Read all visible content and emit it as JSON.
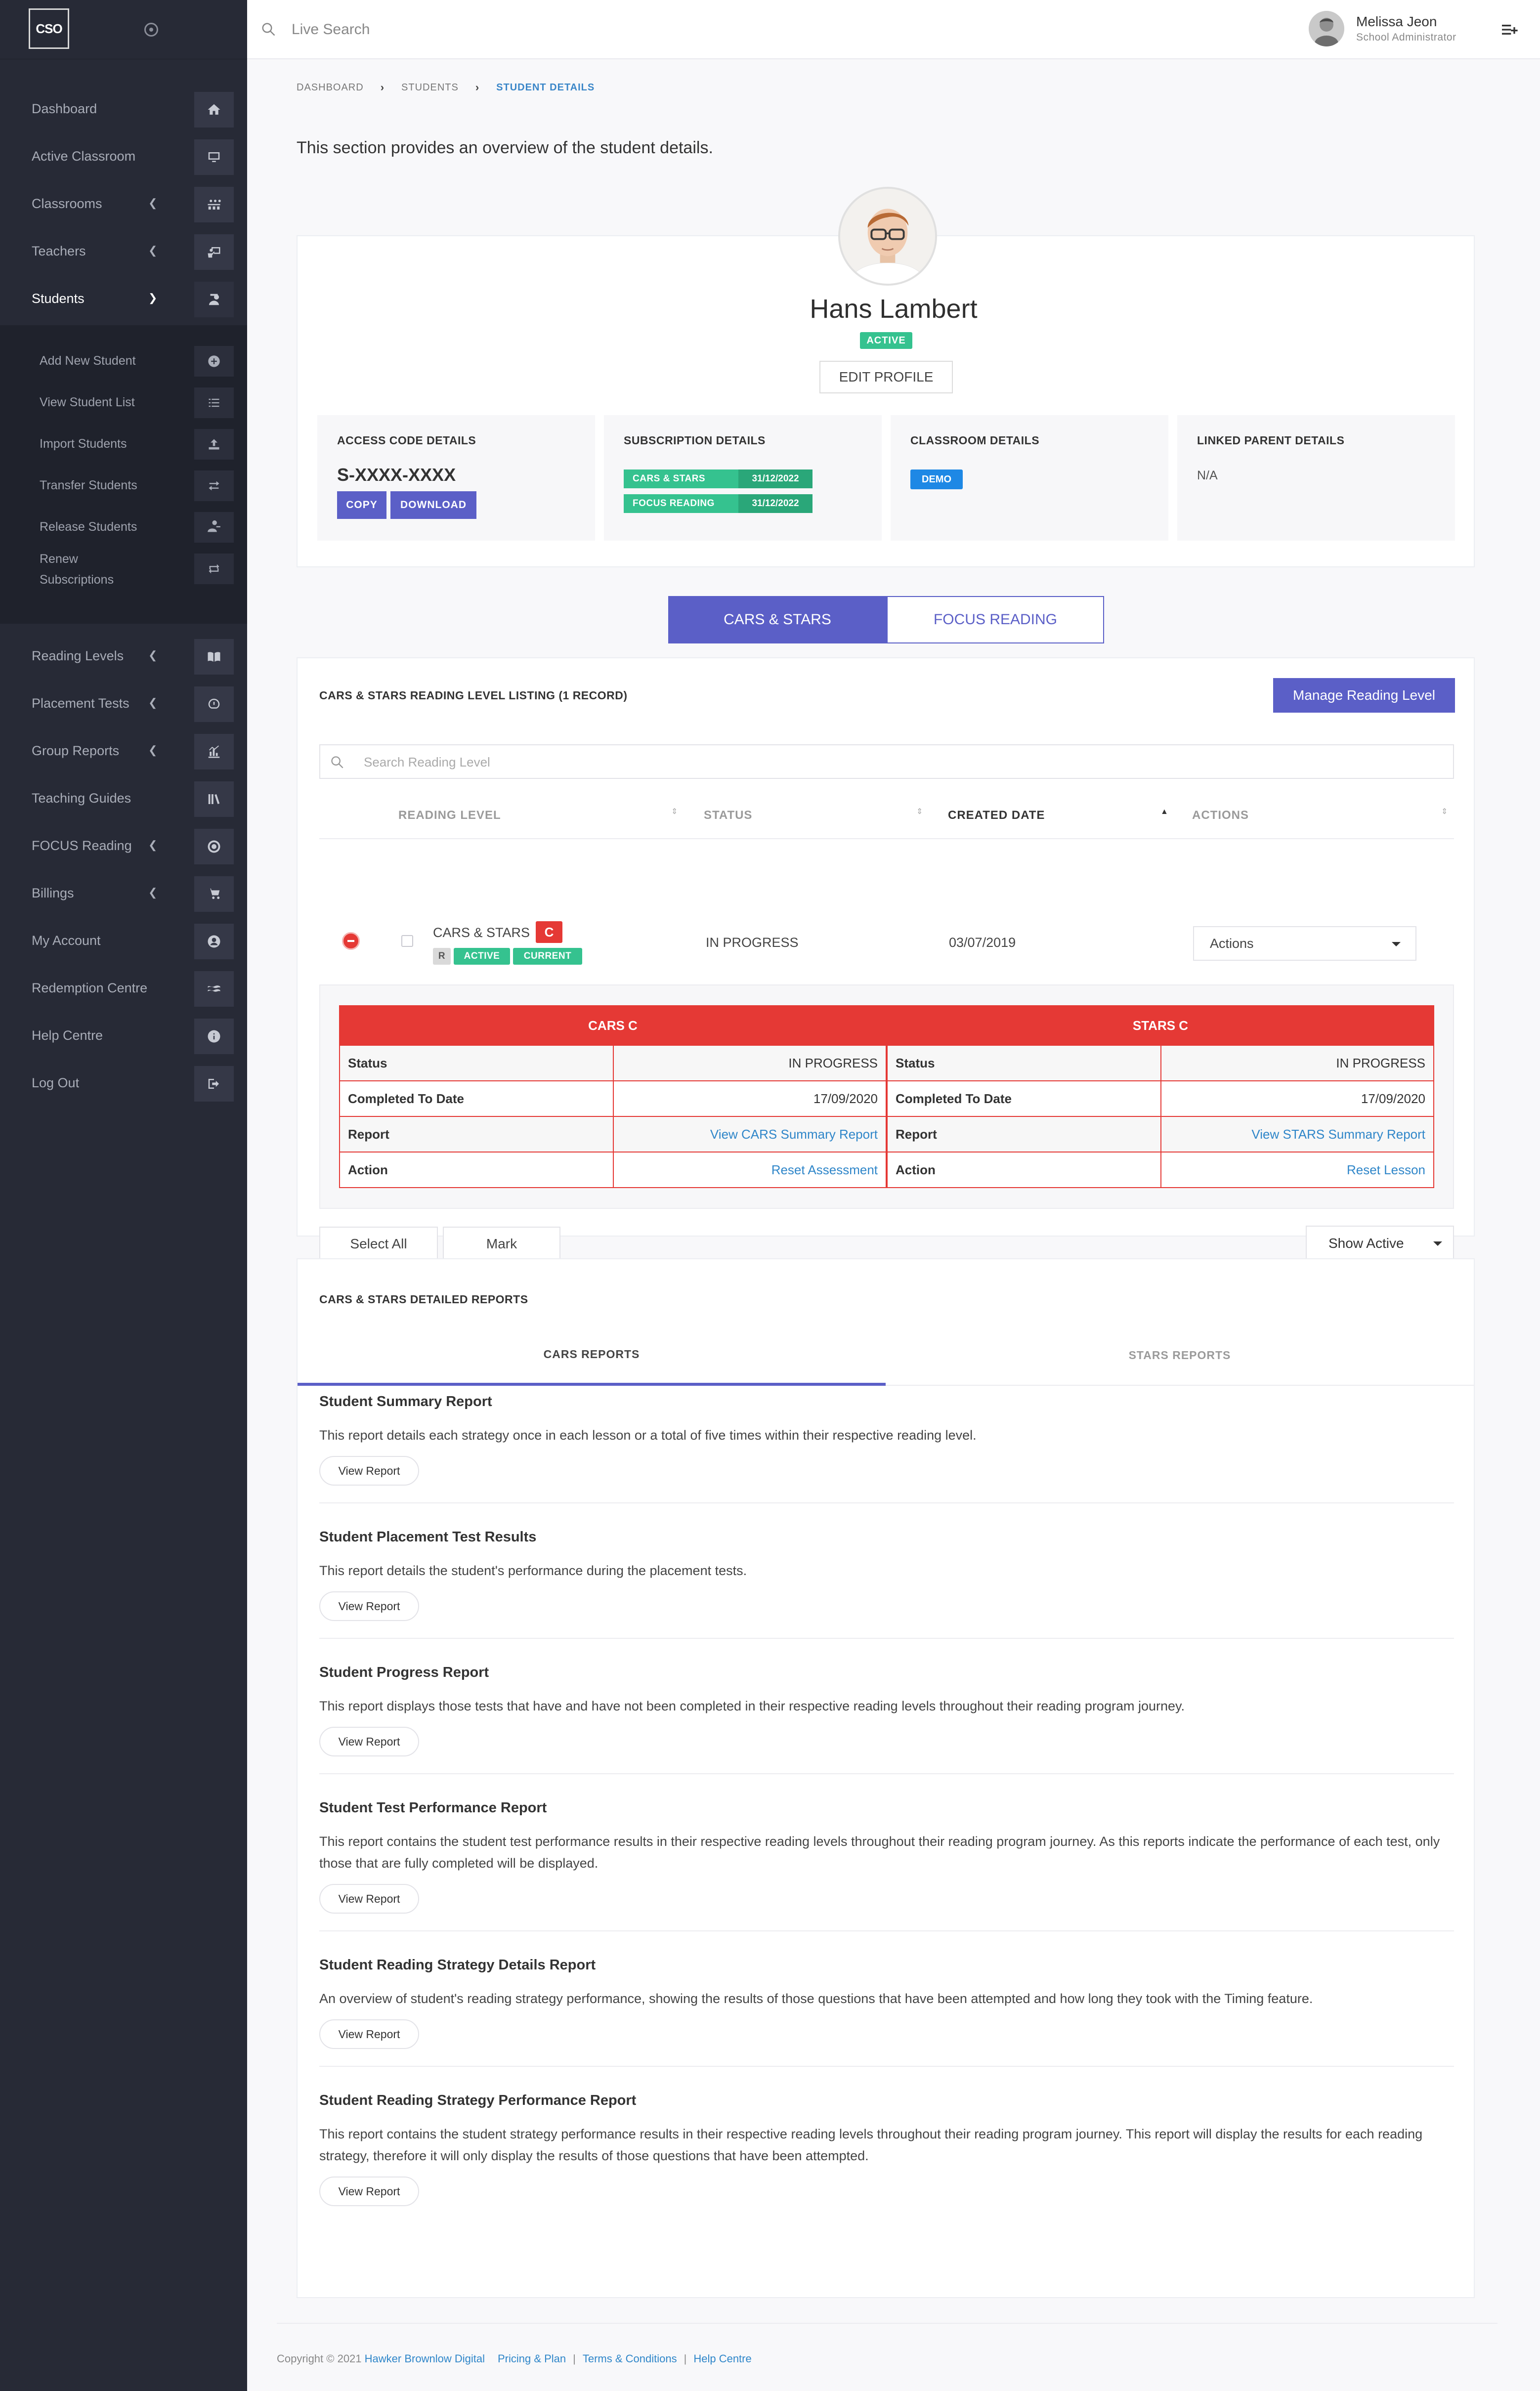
{
  "app": {
    "logo_text": "CSO"
  },
  "header": {
    "search_placeholder": "Live Search",
    "user_name": "Melissa Jeon",
    "user_role": "School Administrator"
  },
  "sidebar": {
    "items": [
      {
        "label": "Dashboard",
        "icon": "home-icon"
      },
      {
        "label": "Active Classroom",
        "icon": "monitor-icon"
      },
      {
        "label": "Classrooms",
        "icon": "classroom-icon"
      },
      {
        "label": "Teachers",
        "icon": "teacher-icon"
      },
      {
        "label": "Students",
        "icon": "student-icon"
      },
      {
        "label": "Reading Levels",
        "icon": "book-icon"
      },
      {
        "label": "Placement Tests",
        "icon": "test-icon"
      },
      {
        "label": "Group Reports",
        "icon": "chart-icon"
      },
      {
        "label": "Teaching Guides",
        "icon": "guides-icon"
      },
      {
        "label": "FOCUS Reading",
        "icon": "focus-icon"
      },
      {
        "label": "Billings",
        "icon": "cart-icon"
      },
      {
        "label": "My Account",
        "icon": "user-circle-icon"
      },
      {
        "label": "Redemption Centre",
        "icon": "redeem-icon"
      },
      {
        "label": "Help Centre",
        "icon": "info-icon"
      },
      {
        "label": "Log Out",
        "icon": "logout-icon"
      }
    ],
    "sub_items": [
      {
        "label": "Add New Student",
        "icon": "plus-circle-icon"
      },
      {
        "label": "View Student List",
        "icon": "list-icon"
      },
      {
        "label": "Import Students",
        "icon": "upload-icon"
      },
      {
        "label": "Transfer Students",
        "icon": "transfer-icon"
      },
      {
        "label": "Release Students",
        "icon": "user-remove-icon"
      },
      {
        "label_line1": "Renew",
        "label_line2": "Subscriptions",
        "icon": "renew-icon"
      }
    ]
  },
  "breadcrumb": {
    "items": [
      "DASHBOARD",
      "STUDENTS",
      "STUDENT DETAILS"
    ]
  },
  "intro_text": "This section provides an overview of the student details.",
  "profile": {
    "name": "Hans Lambert",
    "status": "ACTIVE",
    "edit_label": "EDIT PROFILE"
  },
  "details": {
    "access": {
      "title": "ACCESS CODE DETAILS",
      "code": "S-XXXX-XXXX",
      "copy_label": "COPY",
      "download_label": "DOWNLOAD"
    },
    "subscription": {
      "title": "SUBSCRIPTION DETAILS",
      "rows": [
        {
          "name": "CARS & STARS",
          "date": "31/12/2022"
        },
        {
          "name": "FOCUS READING",
          "date": "31/12/2022"
        }
      ]
    },
    "classroom": {
      "title": "CLASSROOM DETAILS",
      "badge": "DEMO"
    },
    "parent": {
      "title": "LINKED PARENT DETAILS",
      "value": "N/A"
    }
  },
  "program_tabs": [
    "CARS & STARS",
    "FOCUS READING"
  ],
  "listing": {
    "title": "CARS & STARS READING LEVEL LISTING (1 RECORD)",
    "manage_label": "Manage Reading Level",
    "search_placeholder": "Search Reading Level",
    "columns": [
      "READING LEVEL",
      "STATUS",
      "CREATED DATE",
      "ACTIONS"
    ],
    "row": {
      "program": "CARS & STARS",
      "level": "C",
      "tags": [
        "R",
        "ACTIVE",
        "CURRENT"
      ],
      "status": "IN PROGRESS",
      "created": "03/07/2019",
      "actions_label": "Actions"
    },
    "cars": {
      "heading": "CARS C",
      "rows": [
        {
          "k": "Status",
          "v": "IN PROGRESS"
        },
        {
          "k": "Completed To Date",
          "v": "17/09/2020"
        },
        {
          "k": "Report",
          "v": "View CARS Summary Report"
        },
        {
          "k": "Action",
          "v": "Reset Assessment"
        }
      ]
    },
    "stars": {
      "heading": "STARS C",
      "rows": [
        {
          "k": "Status",
          "v": "IN PROGRESS"
        },
        {
          "k": "Completed To Date",
          "v": "17/09/2020"
        },
        {
          "k": "Report",
          "v": "View STARS Summary Report"
        },
        {
          "k": "Action",
          "v": "Reset Lesson"
        }
      ]
    },
    "select_all_label": "Select All",
    "mark_label": "Mark",
    "show_label": "Show Active"
  },
  "reports": {
    "title": "CARS & STARS DETAILED REPORTS",
    "tabs": [
      "CARS REPORTS",
      "STARS REPORTS"
    ],
    "view_label": "View Report",
    "items": [
      {
        "title": "Student Summary Report",
        "desc": "This report details each strategy once in each lesson or a total of five times within their respective reading level."
      },
      {
        "title": "Student Placement Test Results",
        "desc": "This report details the student's performance during the placement tests."
      },
      {
        "title": "Student Progress Report",
        "desc": "This report displays those tests that have and have not been completed in their respective reading levels throughout their reading program journey."
      },
      {
        "title": "Student Test Performance Report",
        "desc": "This report contains the student test performance results in their respective reading levels throughout their reading program journey. As this reports indicate the performance of each test, only those that are fully completed will be displayed."
      },
      {
        "title": "Student Reading Strategy Details Report",
        "desc": "An overview of student's reading strategy performance, showing the results of those questions that have been attempted and how long they took with the Timing feature."
      },
      {
        "title": "Student Reading Strategy Performance Report",
        "desc": "This report contains the student strategy performance results in their respective reading levels throughout their reading program journey. This report will display the results for each reading strategy, therefore it will only display the results of those questions that have been attempted."
      }
    ]
  },
  "footer": {
    "copyright": "Copyright © 2021",
    "company": "Hawker Brownlow Digital",
    "links": [
      "Pricing & Plan",
      "Terms & Conditions",
      "Help Centre"
    ]
  },
  "colors": {
    "sidebar_bg": "#272a36",
    "accent": "#5b5fc7",
    "success": "#35c28f",
    "danger": "#e53935",
    "link": "#2f86c9"
  }
}
